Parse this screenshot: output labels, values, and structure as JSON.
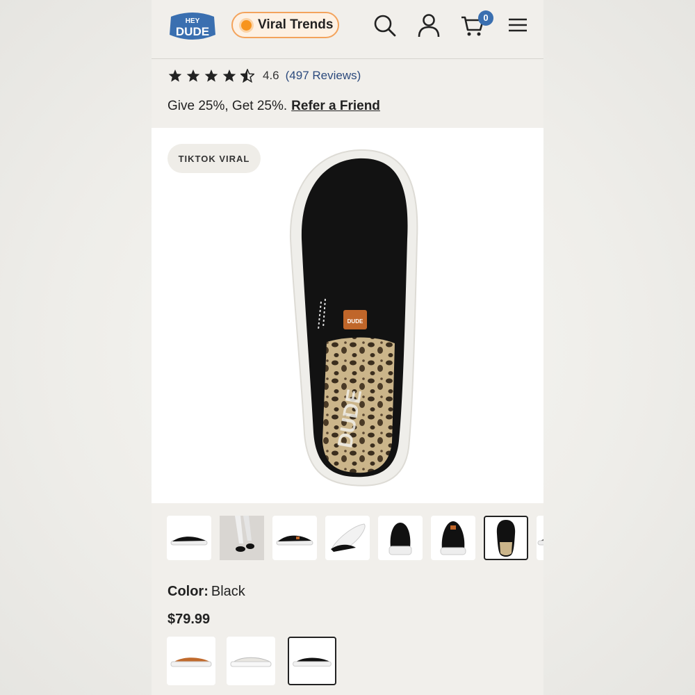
{
  "header": {
    "logo_alt": "HEY DUDE",
    "pill_label": "Viral Trends",
    "cart_count": "0",
    "icons": [
      "search-icon",
      "account-icon",
      "cart-icon",
      "menu-icon"
    ]
  },
  "rating": {
    "value": "4.6",
    "reviews": "(497 Reviews)",
    "stars": 4.5
  },
  "refer": {
    "text": "Give 25%, Get 25%.",
    "link": "Refer a Friend"
  },
  "hero": {
    "tag": "TIKTOK VIRAL"
  },
  "thumbnails": {
    "count": 8,
    "selected_index": 6
  },
  "product": {
    "color_label": "Color:",
    "color_value": "Black",
    "price": "$79.99"
  },
  "swatches": {
    "items": [
      "tan",
      "white",
      "black"
    ],
    "selected_index": 2
  },
  "colors": {
    "accent_orange": "#f7941d",
    "brand_blue": "#3a6fb0",
    "link_blue": "#2c4a7d"
  }
}
